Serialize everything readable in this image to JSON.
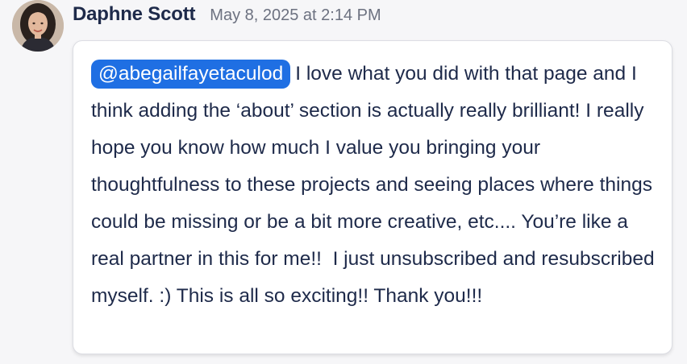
{
  "message": {
    "author": "Daphne Scott",
    "timestamp": "May 8, 2025 at 2:14 PM",
    "avatar_icon": "user-avatar-photo",
    "mention": "@abegailfayetaculod",
    "body": "I love what you did with that page and I think adding the ‘about’ section is actually really brilliant! I really hope you know how much I value you bringing your thoughtfulness to these projects and seeing places where things could be missing or be a bit more creative, etc.... You’re like a real partner in this for me!!  I just unsubscribed and resubscribed myself. :) This is all so exciting!! Thank you!!!"
  },
  "colors": {
    "mention_bg": "#1f6fe3",
    "text": "#1e2a4a",
    "timestamp": "#6c7180",
    "bubble_bg": "#ffffff",
    "page_bg": "#f6f6f8"
  }
}
